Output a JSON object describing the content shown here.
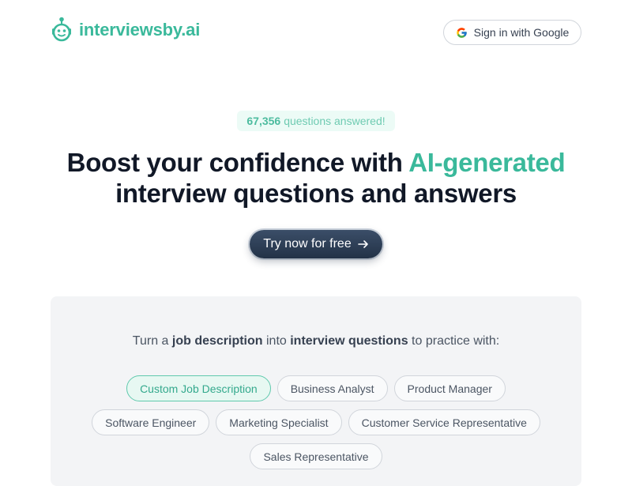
{
  "brand": {
    "name": "interviewsby.ai"
  },
  "header": {
    "signin_label": "Sign in with Google"
  },
  "badge": {
    "count": "67,356",
    "suffix": "questions answered!"
  },
  "hero": {
    "headline_part1": "Boost your confidence with ",
    "headline_accent": "AI-generated",
    "headline_line2": "interview questions and answers",
    "cta_label": "Try now for free"
  },
  "panel": {
    "intro_1": "Turn a ",
    "intro_bold_1": "job description",
    "intro_2": " into ",
    "intro_bold_2": "interview questions",
    "intro_3": " to practice with:",
    "chips": [
      "Custom Job Description",
      "Business Analyst",
      "Product Manager",
      "Software Engineer",
      "Marketing Specialist",
      "Customer Service Representative",
      "Sales Representative"
    ],
    "selected_chip": "Custom Job Description"
  },
  "colors": {
    "accent": "#3ab99b",
    "cta_bg": "#2b3a52",
    "badge_bg": "#ecfbf6",
    "panel_bg": "#f3f4f6"
  },
  "icons": {
    "brand": "robot-logo-icon",
    "signin": "google-icon",
    "cta": "arrow-right-icon"
  }
}
